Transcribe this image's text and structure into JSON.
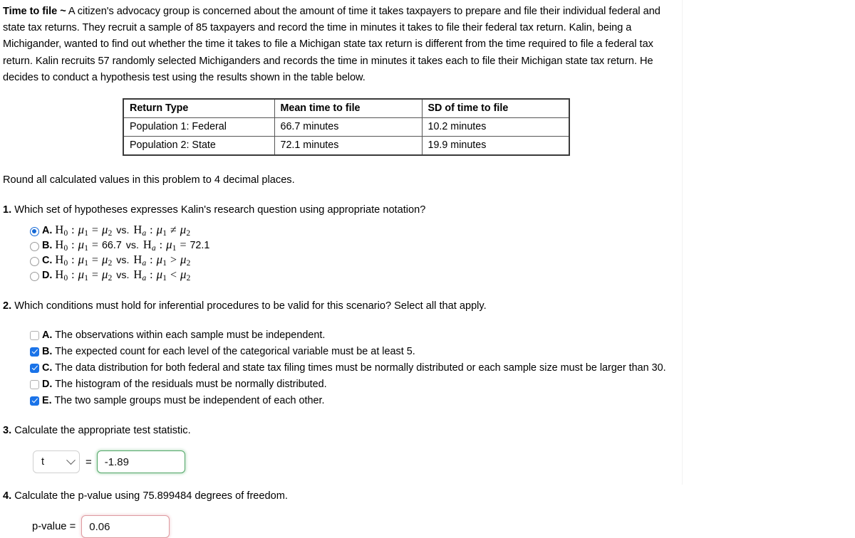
{
  "problem": {
    "title": "Time to file",
    "tilde": "~",
    "body": " A citizen's advocacy group is concerned about the amount of time it takes taxpayers to prepare and file their individual federal and state tax returns. They recruit a sample of 85 taxpayers and record the time in minutes it takes to file their federal tax return. Kalin, being a Michigander, wanted to find out whether the time it takes to file a Michigan state tax return is different from the time required to file a federal tax return. Kalin recruits 57 randomly selected Michiganders and records the time in minutes it takes each to file their Michigan state tax return. He decides to conduct a hypothesis test using the results shown in the table below."
  },
  "table": {
    "headers": [
      "Return Type",
      "Mean time to file",
      "SD of time to file"
    ],
    "rows": [
      [
        "Population 1: Federal",
        "66.7 minutes",
        "10.2 minutes"
      ],
      [
        "Population 2: State",
        "72.1 minutes",
        "19.9 minutes"
      ]
    ]
  },
  "rounding_note": "Round all calculated values in this problem to 4 decimal places.",
  "q1": {
    "number": "1.",
    "text": " Which set of hypotheses expresses Kalin's research question using appropriate notation?",
    "options": [
      {
        "letter": "A.",
        "null_sub": "0",
        "null_left_sub": "1",
        "null_op": "=",
        "null_right": "μ",
        "null_right_sub": "2",
        "alt_sub": "a",
        "alt_left_sub": "1",
        "alt_op": "≠",
        "alt_right": "μ",
        "alt_right_sub": "2",
        "selected": true
      },
      {
        "letter": "B.",
        "null_sub": "0",
        "null_left_sub": "1",
        "null_op": "=",
        "null_right": "66.7",
        "null_right_sub": "",
        "alt_sub": "a",
        "alt_left_sub": "1",
        "alt_op": "=",
        "alt_right": "72.1",
        "alt_right_sub": "",
        "selected": false
      },
      {
        "letter": "C.",
        "null_sub": "0",
        "null_left_sub": "1",
        "null_op": "=",
        "null_right": "μ",
        "null_right_sub": "2",
        "alt_sub": "a",
        "alt_left_sub": "1",
        "alt_op": ">",
        "alt_right": "μ",
        "alt_right_sub": "2",
        "selected": false
      },
      {
        "letter": "D.",
        "null_sub": "0",
        "null_left_sub": "1",
        "null_op": "=",
        "null_right": "μ",
        "null_right_sub": "2",
        "alt_sub": "a",
        "alt_left_sub": "1",
        "alt_op": "<",
        "alt_right": "μ",
        "alt_right_sub": "2",
        "selected": false
      }
    ],
    "glyphs": {
      "H": "H",
      "mu": "μ",
      "vs": "vs.",
      "colon": ":"
    }
  },
  "q2": {
    "number": "2.",
    "text": " Which conditions must hold for inferential procedures to be valid for this scenario? Select all that apply.",
    "options": [
      {
        "letter": "A.",
        "text": " The observations within each sample must be independent.",
        "checked": false
      },
      {
        "letter": "B.",
        "text": " The expected count for each level of the categorical variable must be at least 5.",
        "checked": true
      },
      {
        "letter": "C.",
        "text": " The data distribution for both federal and state tax filing times must be normally distributed or each sample size must be larger than 30.",
        "checked": true
      },
      {
        "letter": "D.",
        "text": " The histogram of the residuals must be normally distributed.",
        "checked": false
      },
      {
        "letter": "E.",
        "text": " The two sample groups must be independent of each other.",
        "checked": true
      }
    ]
  },
  "q3": {
    "number": "3.",
    "text": " Calculate the appropriate test statistic.",
    "statistic_select": "t",
    "equals": "=",
    "value": "-1.89",
    "state": "correct"
  },
  "q4": {
    "number": "4.",
    "text": " Calculate the p-value using 75.899484 degrees of freedom.",
    "label": "p-value =",
    "value": "0.06",
    "state": "incorrect"
  },
  "colors": {
    "radio_selected": "#1569d6",
    "checkbox_checked": "#1a73e8",
    "field_correct_border": "#51a667",
    "field_incorrect_border": "#de9aa0",
    "table_border": "#3a3a3a"
  }
}
